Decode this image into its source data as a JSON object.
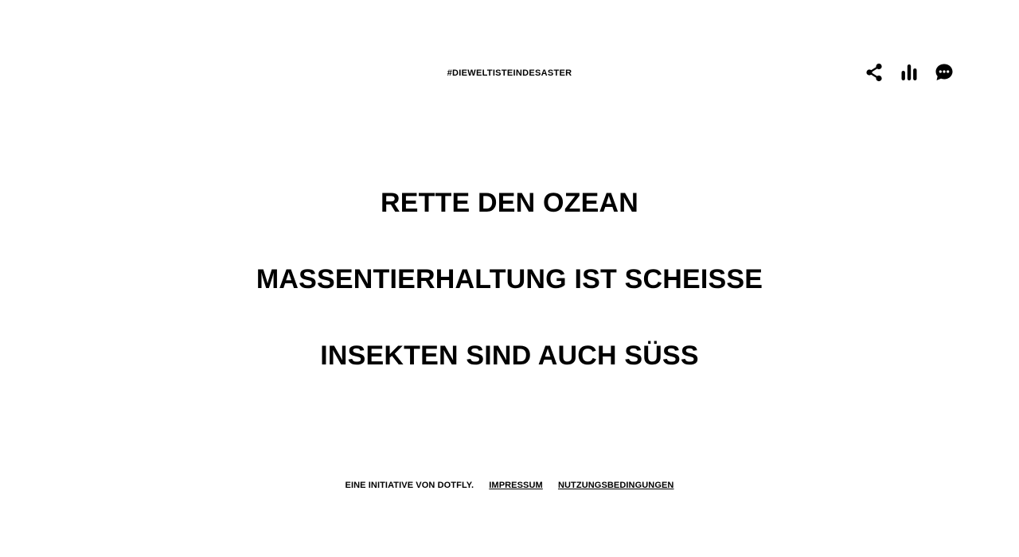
{
  "header": {
    "hashtag": "#DIEWELTISTEINDESASTER",
    "icons": [
      "share-icon",
      "stats-icon",
      "chat-icon"
    ]
  },
  "slogans": [
    "RETTE DEN OZEAN",
    "MASSENTIERHALTUNG IST SCHEISSE",
    "INSEKTEN SIND AUCH SÜSS"
  ],
  "footer": {
    "initiative": "EINE INITIATIVE VON DOTFLY.",
    "impressum": "IMPRESSUM",
    "terms": "NUTZUNGSBEDINGUNGEN"
  },
  "colors": {
    "text": "#000000",
    "background": "#ffffff"
  }
}
